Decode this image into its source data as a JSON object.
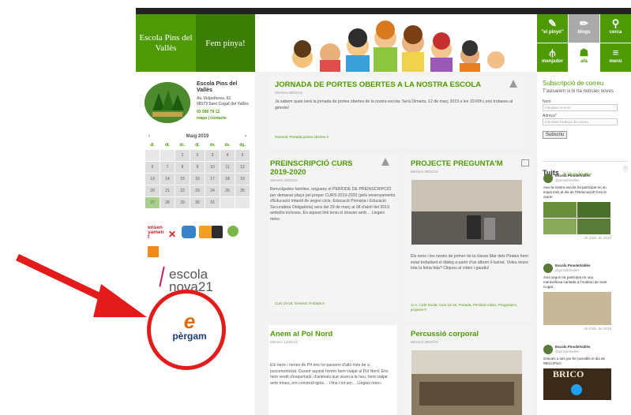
{
  "brand": {
    "name": "Escola Pins del Vallès",
    "slogan": "Fem pinya!"
  },
  "tiles": [
    {
      "label": "\"el pinyó\"",
      "color": "#4e9a06",
      "icon": "note-icon"
    },
    {
      "label": "blogs",
      "color": "#aaaaaa",
      "icon": "pencil-icon"
    },
    {
      "label": "cerca",
      "color": "#4e9a06",
      "icon": "search-icon"
    },
    {
      "label": "menjador",
      "color": "#4e9a06",
      "icon": "cutlery-icon"
    },
    {
      "label": "afa",
      "color": "#ffffff",
      "icon": "people-icon"
    },
    {
      "label": "menú",
      "color": "#4e9a06",
      "icon": "menu-icon"
    }
  ],
  "school": {
    "name": "Escola Pins del Vallès",
    "address1": "Av. Volpelleres, 51",
    "address2": "08173 Sant Cugat del Vallès",
    "phone": "93 590 79 12",
    "links": "mapa | contacte"
  },
  "calendar": {
    "month": "Maig 2019",
    "prev": "‹",
    "next": "›",
    "days": [
      "dl.",
      "dt.",
      "dc.",
      "dj.",
      "dv.",
      "ds.",
      "dg."
    ],
    "cells": [
      "",
      "",
      "1",
      "2",
      "3",
      "4",
      "5",
      "6",
      "7",
      "8",
      "9",
      "10",
      "11",
      "12",
      "13",
      "14",
      "15",
      "16",
      "17",
      "18",
      "19",
      "20",
      "21",
      "22",
      "23",
      "24",
      "25",
      "26",
      "27",
      "28",
      "29",
      "30",
      "31",
      "",
      ""
    ]
  },
  "partners": {
    "ensenyament": "ensenyament",
    "escolanova": "escola nova21",
    "pergam": "pèrgam"
  },
  "posts": {
    "p1": {
      "title": "JORNADA DE PORTES OBERTES A LA NOSTRA ESCOLA",
      "meta": "Mestres   08/02/19",
      "text": "Ja sabem quan serà la jornada de portes obertes de la nostra escola: Serà Dimarts, 12 de març 2019 a les 10:00h i ens trobareu al gimnàs!",
      "foot": "General, Portada  portes obertes  0"
    },
    "p2": {
      "title": "PREINSCRIPCIÓ CURS 2019-2020",
      "meta": "Mestres   22/03/19",
      "text": "Benvolgudes famílies, enguany el PERÍODE DE PREINSCRIPCIÓ per demanar plaça pel proper CURS 2019-2020 (pels ensenyaments d'Educació Infantil de segon cicle, Educació Primària i Educació Secundària Obligatòria) serà del 29 de març al 08 d'abril del 2019, ambdós inclosos. En aquest link teniu el dossier amb… Llegeix més»",
      "foot": "Curs 19-19, General, Portada  0"
    },
    "p3": {
      "title": "PROJECTE PREGUNTA'M",
      "meta": "Mestres   08/03/19",
      "text": "Els nens i les nenes de primer de la classe Mar dels Pirates hem estat treballant el diàleg a partir d'un àlbum il·lustrat. Voleu veure tota la feina feta? Cliqueu al vídeo i gaudiu!",
      "foot": "1r A, Cicle Inicial, Curs 18-19, Portada, Primària  Vídeo, Pregunta'm, projecte  0"
    },
    "p4": {
      "title": "Anem al Pol Nord",
      "meta": "Mestres   12/03/19",
      "text": "Els nens i nenes de P4 ens ho passem d'allò més bé a psicomotricitat. Durant aquest hivern hem viatjat al Pol Nord. Ens hem vestit d'esquimals, d'animals que viuen a la neu, hem viatjat amb trineu, em construït iglús… i fins i tot am… Llegeix més»"
    },
    "p5": {
      "title": "Percussió corporal",
      "meta": "Mestres   06/03/19"
    }
  },
  "subscribe": {
    "title": "Subscripció de correu",
    "desc": "T'avisarem si hi ha notícies noves",
    "name_label": "Nom",
    "name_placeholder": "Introduïu el nom",
    "email_label": "Adreça*",
    "email_placeholder": "Introduïu l'adreça de correu",
    "button": "Subscriu"
  },
  "tweets": {
    "title": "Tuits",
    "handle": "de @pinsdelvalles",
    "t1": {
      "user": "Escola PinsdelVallès",
      "handle": "@pinsdelvalles",
      "text": "Avui la nostra escola ha participat en un espai més al dia de l'#EducacióP fora al carrer.",
      "time": "25 d'abr. de 2019"
    },
    "t2": {
      "user": "Escola PinsdelVallès",
      "handle": "@pinsdelvalles",
      "text": "Avui segon ha participat en una meravellosa cantada a l'Auditori de Sant Cugat.",
      "time": "26 d'abr. de 2019"
    },
    "t3": {
      "user": "Escola PinsdelVallès",
      "handle": "@pinsdelvalles",
      "text": "Gràcies a tots per fer possible el dia de #BricoPins!",
      "video": "BRICO"
    }
  }
}
